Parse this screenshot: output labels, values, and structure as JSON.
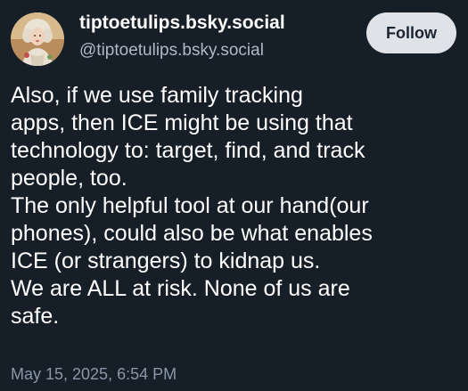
{
  "post": {
    "author": {
      "display_name": "tiptoetulips.bsky.social",
      "handle": "@tiptoetulips.bsky.social",
      "avatar_icon": "portrait-avatar"
    },
    "follow_label": "Follow",
    "text_lines": [
      "Also, if we use family tracking",
      "apps, then ICE might be using that",
      "technology to: target, find, and track",
      "people, too.",
      "The only helpful tool at our hand(our",
      "phones), could also be what enables",
      "ICE (or strangers) to kidnap us.",
      "We are ALL at risk. None of us are",
      "safe."
    ],
    "timestamp": "May 15, 2025, 6:54 PM"
  },
  "colors": {
    "background": "#161e27",
    "text": "#ffffff",
    "handle": "#aeb9c7",
    "timestamp": "#8a97a8",
    "follow_button_bg": "#dfe3e8"
  }
}
